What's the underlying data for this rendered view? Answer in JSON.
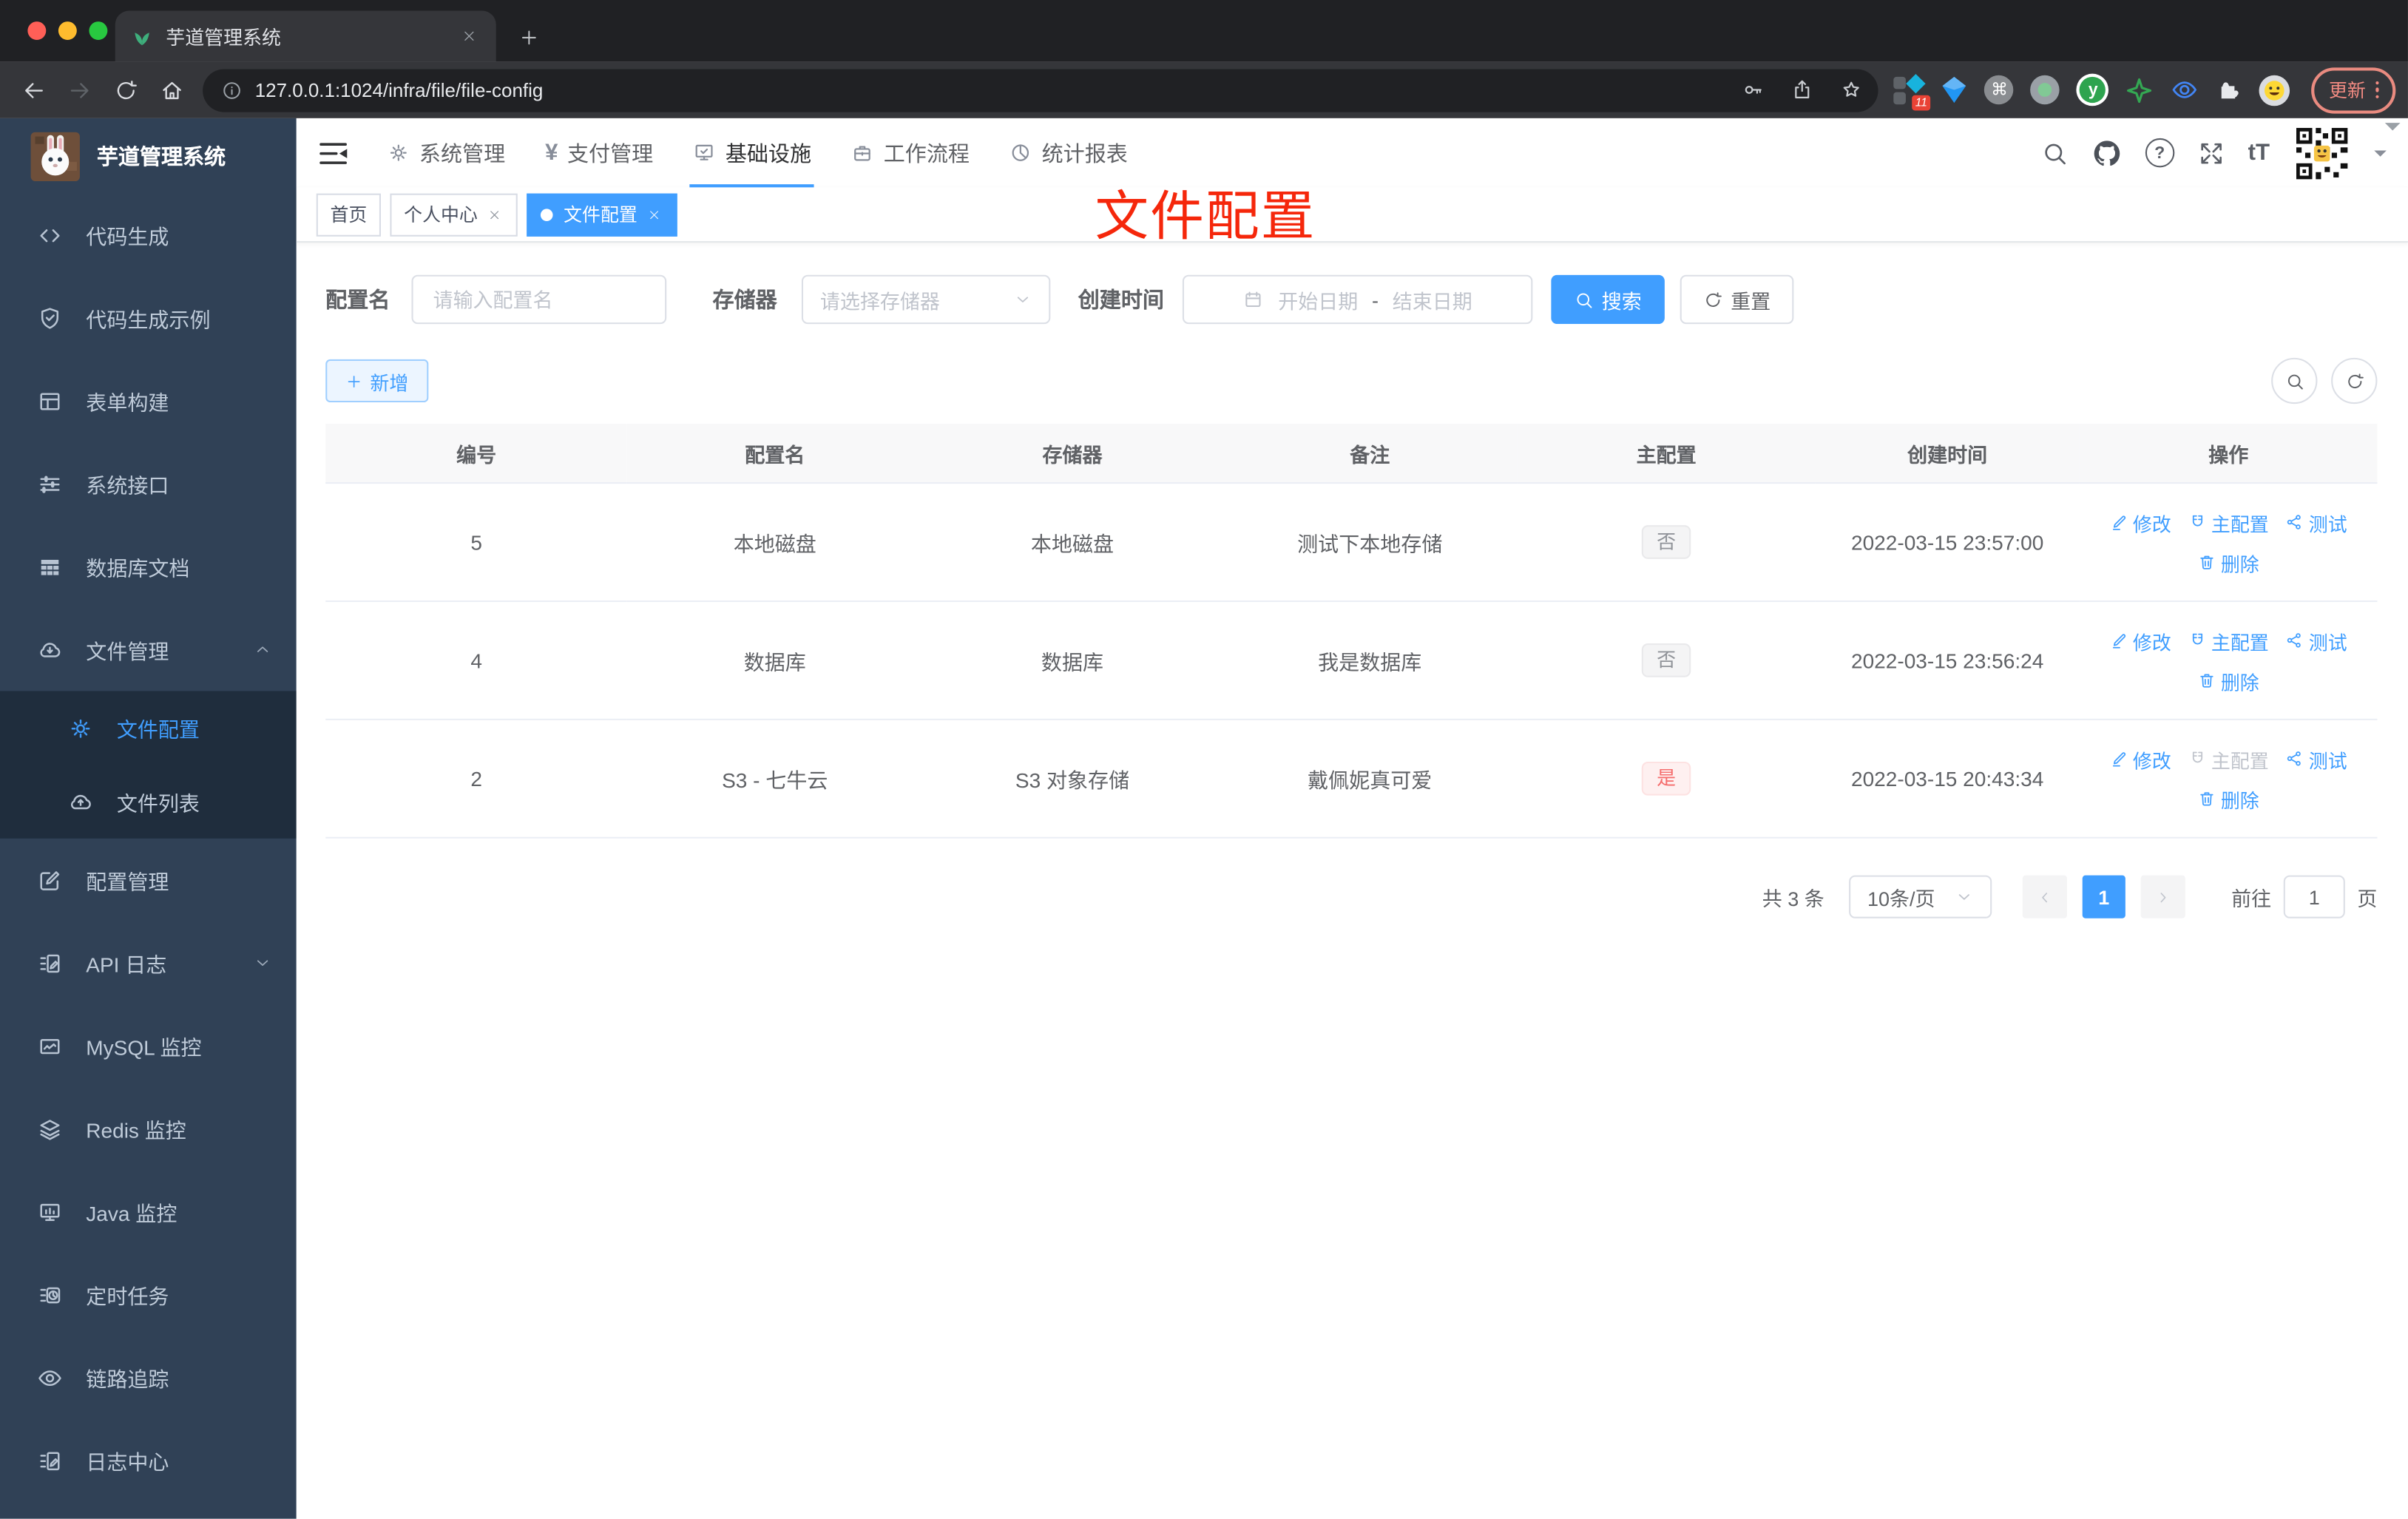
{
  "colors": {
    "accent": "#409eff",
    "danger": "#f56c6c",
    "annotation_red": "#f5270b",
    "sidebar_bg": "#304156"
  },
  "browser": {
    "tab_title": "芋道管理系统",
    "url": "127.0.0.1:1024/infra/file/file-config",
    "extension_badge": "11",
    "update_label": "更新"
  },
  "icons": {
    "cmd": "⌘",
    "y_label": "y",
    "help": "?",
    "font_size": "tT",
    "yen": "¥"
  },
  "sidebar": {
    "logo_title": "芋道管理系统",
    "items": [
      {
        "label": "代码生成"
      },
      {
        "label": "代码生成示例"
      },
      {
        "label": "表单构建"
      },
      {
        "label": "系统接口"
      },
      {
        "label": "数据库文档"
      },
      {
        "label": "文件管理"
      },
      {
        "label": "文件配置"
      },
      {
        "label": "文件列表"
      },
      {
        "label": "配置管理"
      },
      {
        "label": "API 日志"
      },
      {
        "label": "MySQL 监控"
      },
      {
        "label": "Redis 监控"
      },
      {
        "label": "Java 监控"
      },
      {
        "label": "定时任务"
      },
      {
        "label": "链路追踪"
      },
      {
        "label": "日志中心"
      }
    ]
  },
  "topnav": {
    "items": [
      {
        "label": "系统管理"
      },
      {
        "label": "支付管理"
      },
      {
        "label": "基础设施",
        "active": true
      },
      {
        "label": "工作流程"
      },
      {
        "label": "统计报表"
      }
    ]
  },
  "tags": [
    {
      "label": "首页"
    },
    {
      "label": "个人中心"
    },
    {
      "label": "文件配置",
      "active": true
    }
  ],
  "annotation": {
    "text": "文件配置"
  },
  "filter": {
    "name_label": "配置名",
    "name_placeholder": "请输入配置名",
    "storage_label": "存储器",
    "storage_placeholder": "请选择存储器",
    "time_label": "创建时间",
    "start_placeholder": "开始日期",
    "separator": "-",
    "end_placeholder": "结束日期",
    "search_label": "搜索",
    "reset_label": "重置"
  },
  "toolbar": {
    "add_label": "新增"
  },
  "table": {
    "headers": [
      "编号",
      "配置名",
      "存储器",
      "备注",
      "主配置",
      "创建时间",
      "操作"
    ],
    "actions": {
      "edit": "修改",
      "master": "主配置",
      "test": "测试",
      "delete": "删除"
    },
    "rows": [
      {
        "id": "5",
        "name": "本地磁盘",
        "storage": "本地磁盘",
        "remark": "测试下本地存储",
        "master": "否",
        "created": "2022-03-15 23:57:00"
      },
      {
        "id": "4",
        "name": "数据库",
        "storage": "数据库",
        "remark": "我是数据库",
        "master": "否",
        "created": "2022-03-15 23:56:24"
      },
      {
        "id": "2",
        "name": "S3 - 七牛云",
        "storage": "S3 对象存储",
        "remark": "戴佩妮真可爱",
        "master": "是",
        "created": "2022-03-15 20:43:34"
      }
    ]
  },
  "pagination": {
    "total": "共 3 条",
    "page_size": "10条/页",
    "current": "1",
    "goto_label": "前往",
    "goto_value": "1",
    "page_suffix": "页"
  }
}
